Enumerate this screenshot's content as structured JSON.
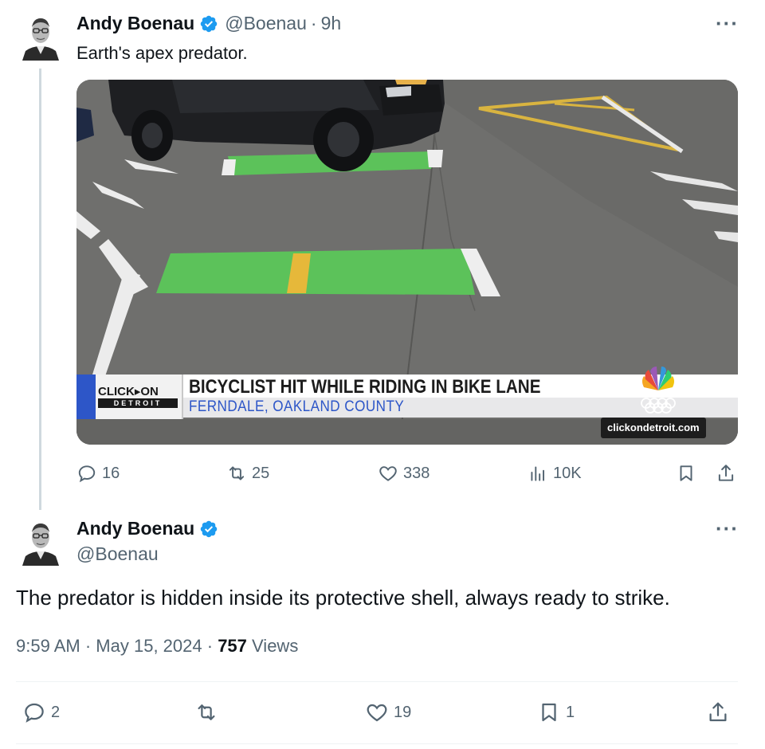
{
  "tweet1": {
    "author": "Andy Boenau",
    "handle": "@Boenau",
    "separator": "·",
    "time": "9h",
    "text": "Earth's apex predator.",
    "more_icon": "more-horizontal-icon",
    "media": {
      "headline": "BICYCLIST HIT WHILE RIDING IN BIKE LANE",
      "subline": "FERNDALE, OAKLAND COUNTY",
      "logo_top": "CLICK▸ON",
      "logo_bottom": "DETROIT",
      "watermark": "clickondetroit.com"
    },
    "actions": {
      "replies": "16",
      "reposts": "25",
      "likes": "338",
      "views": "10K"
    }
  },
  "tweet2": {
    "author": "Andy Boenau",
    "handle": "@Boenau",
    "text": "The predator is hidden inside its protective shell, always ready to strike.",
    "time": "9:59 AM",
    "dot1": "·",
    "date": "May 15, 2024",
    "dot2": "·",
    "views_count": "757",
    "views_label": "Views",
    "actions": {
      "replies": "2",
      "reposts": "",
      "likes": "19",
      "bookmarks": "1"
    }
  },
  "colors": {
    "verified": "#1d9bf0",
    "secondary_text": "#536471",
    "primary_text": "#0f1419",
    "bike_lane_green": "#5cc25a"
  }
}
